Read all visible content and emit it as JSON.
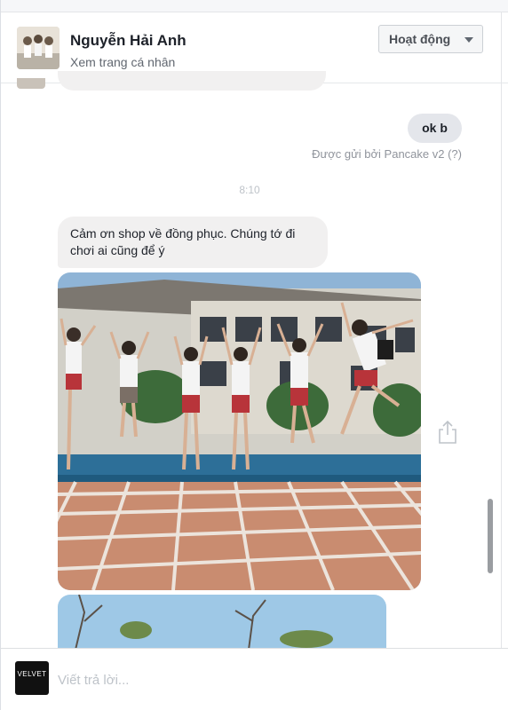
{
  "header": {
    "name": "Nguyễn Hải Anh",
    "profile_link": "Xem trang cá nhân",
    "status_button": "Hoạt động"
  },
  "messages": {
    "sent_text": "ok b",
    "sent_by": "Được gửi bởi Pancake v2 (?)",
    "timestamp": "8:10",
    "received_text": "Cảm ơn shop về đồng phục. Chúng tớ đi chơi ai cũng để ý"
  },
  "composer": {
    "placeholder": "Viết trả lời...",
    "logo_text": "VELVET"
  },
  "colors": {
    "bubble_gray": "#f1f0f0",
    "sent_bubble": "#e4e6eb",
    "muted_text": "#90949c"
  }
}
